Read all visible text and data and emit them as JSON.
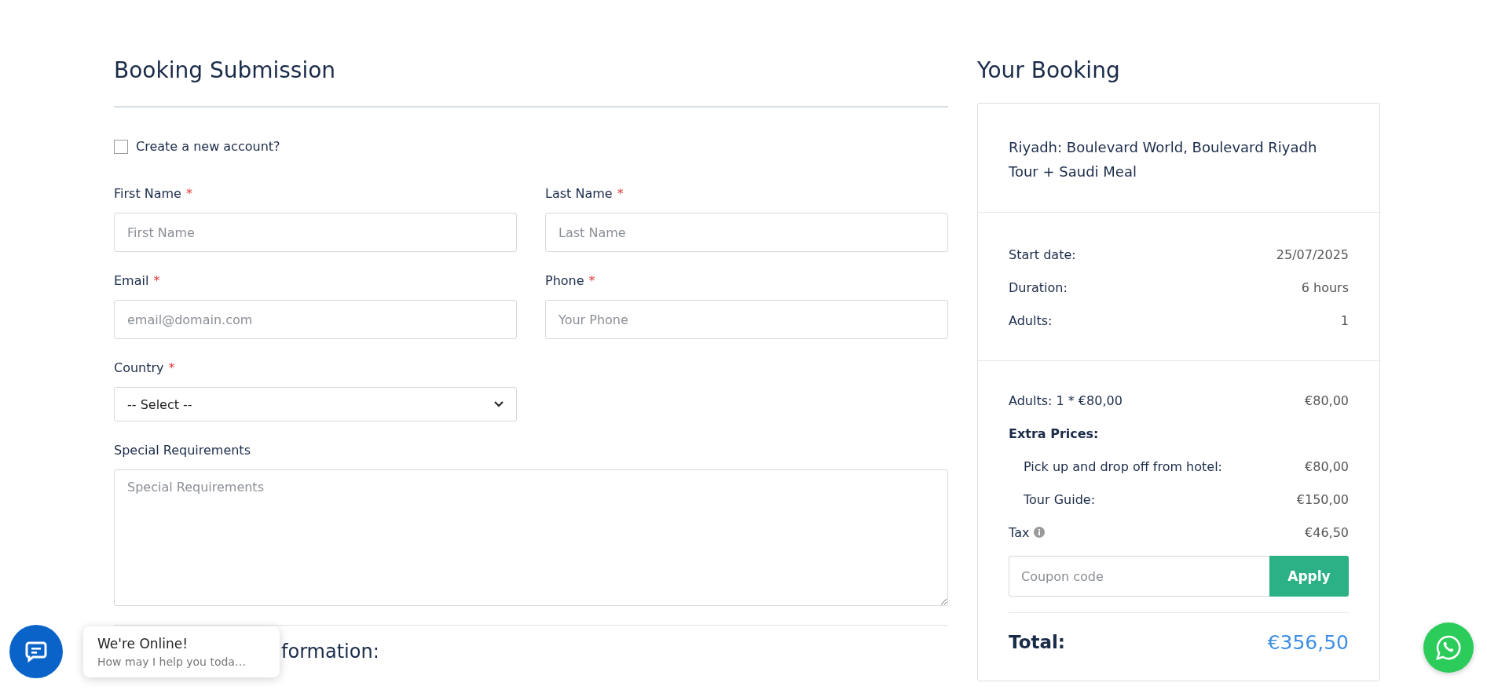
{
  "heading": "Booking Submission",
  "account_checkbox": {
    "label": "Create a new account?",
    "checked": false
  },
  "fields": [
    {
      "kind": "input",
      "label": "First Name",
      "required_mark": "*",
      "placeholder": "First Name"
    },
    {
      "kind": "input",
      "label": "Last Name",
      "required_mark": "*",
      "placeholder": "Last Name"
    },
    {
      "kind": "input",
      "label": "Email",
      "required_mark": "*",
      "placeholder": "email@domain.com"
    },
    {
      "kind": "input",
      "label": "Phone",
      "required_mark": "*",
      "placeholder": "Your Phone"
    },
    {
      "kind": "select",
      "label": "Country",
      "required_mark": "*",
      "value": "-- Select --"
    },
    {
      "kind": "textarea",
      "label": "Special Requirements",
      "placeholder": "Special Requirements"
    }
  ],
  "next_section": {
    "heading": "formation:"
  },
  "summary": {
    "heading": "Your Booking",
    "tour_title": "Riyadh: Boulevard World, Boulevard Riyadh Tour + Saudi Meal",
    "details": [
      {
        "label": "Start date:",
        "value": "25/07/2025"
      },
      {
        "label": "Duration:",
        "value": "6 hours"
      },
      {
        "label": "Adults:",
        "value": "1"
      }
    ],
    "prices": [
      {
        "kind": "line",
        "label": "Adults: 1 * €80,00",
        "value": "€80,00"
      },
      {
        "kind": "group",
        "label": "Extra Prices:"
      },
      {
        "kind": "sub",
        "label": "Pick up and drop off from hotel:",
        "value": "€80,00"
      },
      {
        "kind": "sub",
        "label": "Tour Guide:",
        "value": "€150,00"
      },
      {
        "kind": "tax",
        "label": "Tax",
        "value": "€46,50"
      }
    ],
    "coupon": {
      "placeholder": "Coupon code",
      "button": "Apply"
    },
    "total": {
      "label": "Total:",
      "value": "€356,50"
    }
  },
  "chat": {
    "title": "We're Online!",
    "message": "How may I help you toda…"
  }
}
